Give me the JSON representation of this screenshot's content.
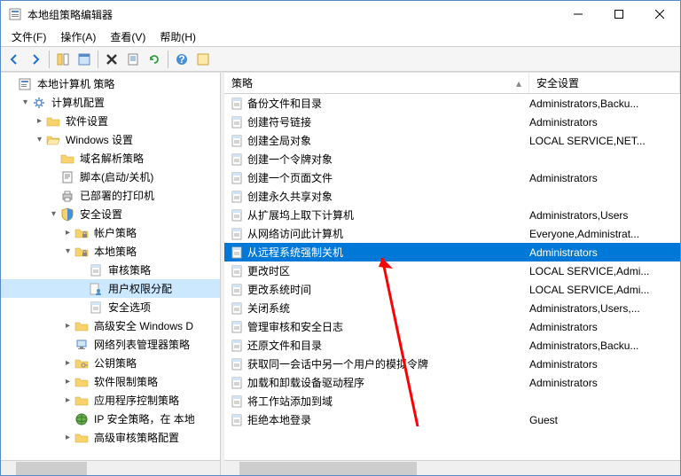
{
  "window": {
    "title": "本地组策略编辑器"
  },
  "menu": {
    "file": "文件(F)",
    "action": "操作(A)",
    "view": "查看(V)",
    "help": "帮助(H)"
  },
  "tree": {
    "root": "本地计算机 策略",
    "computer": "计算机配置",
    "software": "软件设置",
    "windows": "Windows 设置",
    "dns": "域名解析策略",
    "scripts": "脚本(启动/关机)",
    "printers": "已部署的打印机",
    "security": "安全设置",
    "account": "帐户策略",
    "local": "本地策略",
    "audit": "审核策略",
    "rights": "用户权限分配",
    "options": "安全选项",
    "advfw": "高级安全 Windows D",
    "netlist": "网络列表管理器策略",
    "pubkey": "公钥策略",
    "softrest": "软件限制策略",
    "appctrl": "应用程序控制策略",
    "ipsec": "IP 安全策略，在 本地",
    "advaudit": "高级审核策略配置"
  },
  "columns": {
    "policy": "策略",
    "security": "安全设置"
  },
  "policies": [
    {
      "name": "备份文件和目录",
      "value": "Administrators,Backu..."
    },
    {
      "name": "创建符号链接",
      "value": "Administrators"
    },
    {
      "name": "创建全局对象",
      "value": "LOCAL SERVICE,NET..."
    },
    {
      "name": "创建一个令牌对象",
      "value": ""
    },
    {
      "name": "创建一个页面文件",
      "value": "Administrators"
    },
    {
      "name": "创建永久共享对象",
      "value": ""
    },
    {
      "name": "从扩展坞上取下计算机",
      "value": "Administrators,Users"
    },
    {
      "name": "从网络访问此计算机",
      "value": "Everyone,Administrat..."
    },
    {
      "name": "从远程系统强制关机",
      "value": "Administrators",
      "selected": true
    },
    {
      "name": "更改时区",
      "value": "LOCAL SERVICE,Admi..."
    },
    {
      "name": "更改系统时间",
      "value": "LOCAL SERVICE,Admi..."
    },
    {
      "name": "关闭系统",
      "value": "Administrators,Users,..."
    },
    {
      "name": "管理审核和安全日志",
      "value": "Administrators"
    },
    {
      "name": "还原文件和目录",
      "value": "Administrators,Backu..."
    },
    {
      "name": "获取同一会话中另一个用户的模拟令牌",
      "value": "Administrators"
    },
    {
      "name": "加载和卸载设备驱动程序",
      "value": "Administrators"
    },
    {
      "name": "将工作站添加到域",
      "value": ""
    },
    {
      "name": "拒绝本地登录",
      "value": "Guest"
    }
  ]
}
